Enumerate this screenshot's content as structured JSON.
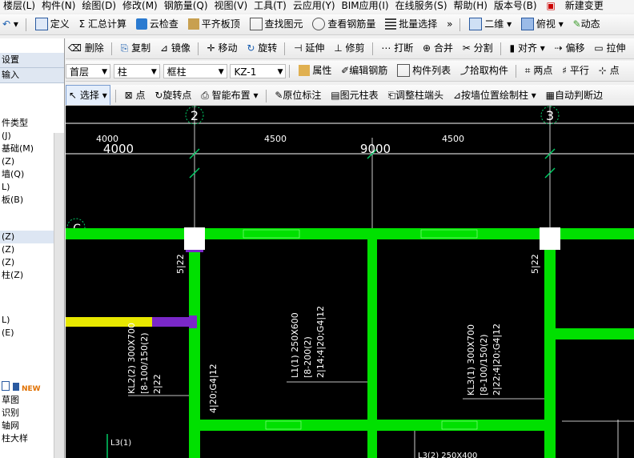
{
  "menubar": [
    "楼层(L)",
    "构件(N)",
    "绘图(D)",
    "修改(M)",
    "钢筋量(Q)",
    "视图(V)",
    "工具(T)",
    "云应用(Y)",
    "BIM应用(I)",
    "在线服务(S)",
    "帮助(H)",
    "版本号(B)",
    "新建变更"
  ],
  "toolbar1": {
    "items": [
      "定义",
      "汇总计算",
      "云检查",
      "平齐板顶",
      "查找图元",
      "查看钢筋量",
      "批量选择"
    ],
    "view_mode": "二维",
    "view_dir": "俯视",
    "dynamic": "动态"
  },
  "toolbar2": {
    "items": [
      "删除",
      "复制",
      "镜像",
      "移动",
      "旋转",
      "延伸",
      "修剪",
      "打断",
      "合并",
      "分割",
      "对齐",
      "偏移",
      "拉伸"
    ]
  },
  "toolbar3": {
    "floor": "首层",
    "category": "柱",
    "subtype": "框柱",
    "component": "KZ-1",
    "items": [
      "属性",
      "编辑钢筋",
      "构件列表",
      "拾取构件",
      "两点",
      "平行",
      "点"
    ]
  },
  "toolbar4": {
    "items": [
      "选择",
      "点",
      "旋转点",
      "智能布置",
      "原位标注",
      "图元柱表",
      "调整柱端头",
      "按墙位置绘制柱",
      "自动判断边"
    ]
  },
  "sidebar": {
    "header1": "设置",
    "header2": "输入",
    "items": [
      "件类型",
      "(J)",
      "基础(M)",
      "(Z)",
      "墙(Q)",
      "L)",
      "板(B)",
      "",
      "(Z)",
      "(Z)",
      "(Z)",
      "柱(Z)",
      "",
      "",
      "L)",
      "(E)",
      "",
      "",
      "",
      "",
      "",
      "草图",
      "识别",
      "轴网",
      "柱大样"
    ],
    "new_badge": "NEW"
  },
  "canvas": {
    "axis_labels": [
      "2",
      "3",
      "C"
    ],
    "dims_top": [
      "4000",
      "4500",
      "4500"
    ],
    "dims_big": [
      "4000",
      "9000"
    ],
    "col_notes": [
      "5|22",
      "5|22"
    ],
    "beam_kl2": [
      "KL2(2) 300X700",
      "[8-100/150(2)",
      "2|22"
    ],
    "beam_kl2_side": "4|20;G4|12",
    "beam_l1": [
      "L1(1) 250X600",
      "[8-200(2)",
      "2|14;4|20;G4|12"
    ],
    "beam_kl3": [
      "KL3(1) 300X700",
      "[8-100/150(2)",
      "2|22;4|20;G4|12"
    ],
    "bottom_notes": [
      "L3(1)",
      "L3(2) 250X400"
    ]
  },
  "colors": {
    "beam": "#00e000",
    "beam_yellow": "#e8e800",
    "beam_purple": "#7a28c8",
    "grid": "#ffffff",
    "bg": "#000000"
  }
}
